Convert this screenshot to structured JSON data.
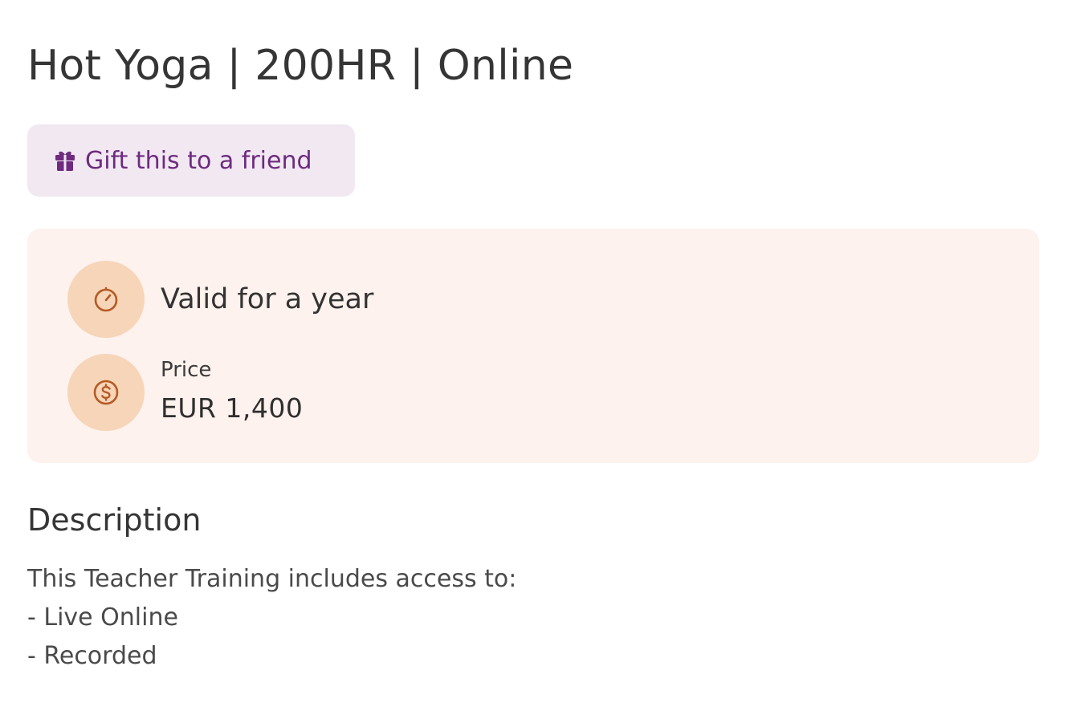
{
  "course": {
    "title": "Hot Yoga | 200HR | Online"
  },
  "gift": {
    "label": "Gift this to a friend",
    "icon": "gift-icon"
  },
  "info": {
    "validity": {
      "icon": "stopwatch-icon",
      "text": "Valid for a year"
    },
    "price": {
      "icon": "dollar-circle-icon",
      "label": "Price",
      "value": "EUR 1,400"
    }
  },
  "description": {
    "heading": "Description",
    "lines": [
      "This Teacher Training includes access to:",
      "- Live Online",
      "- Recorded"
    ]
  },
  "colors": {
    "accent_purple": "#6e2b7f",
    "gift_button_bg": "#f1e8f2",
    "info_card_bg": "#fdf2ed",
    "icon_circle_bg": "#f6d5b9",
    "icon_stroke": "#b65a24"
  }
}
